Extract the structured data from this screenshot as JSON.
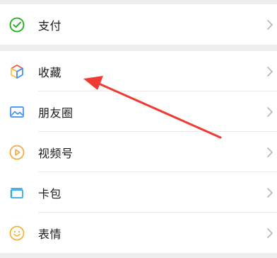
{
  "colors": {
    "page_bg": "#ededed",
    "row_bg": "#ffffff",
    "divider": "#e9e9e9",
    "pay_green": "#1aad19",
    "favorites_red": "#f25643",
    "favorites_yellow": "#f7c042",
    "favorites_blue": "#3e8ef7",
    "moments_blue": "#3e8ef7",
    "channels_orange": "#f2a93b",
    "cards_teal": "#2eaadc",
    "stickers_yellow": "#f2b233",
    "chevron": "#b5b5b5",
    "annotation_arrow": "#ee3b33"
  },
  "menu": {
    "pay": {
      "label": "支付",
      "icon": "pay-checkmark-icon"
    },
    "items": [
      {
        "label": "收藏",
        "icon": "favorites-cube-icon"
      },
      {
        "label": "朋友圈",
        "icon": "moments-picture-icon"
      },
      {
        "label": "视频号",
        "icon": "channels-play-icon"
      },
      {
        "label": "卡包",
        "icon": "card-wallet-icon"
      },
      {
        "label": "表情",
        "icon": "sticker-smile-icon"
      }
    ]
  },
  "annotation": {
    "type": "arrow",
    "points_to": "收藏"
  }
}
